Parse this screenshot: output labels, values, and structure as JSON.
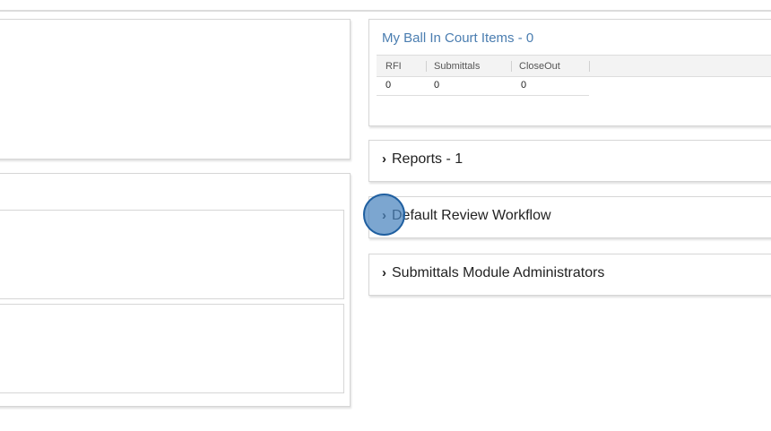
{
  "ball_in_court": {
    "title": "My Ball In Court Items - 0",
    "columns": [
      "RFI",
      "Submittals",
      "CloseOut"
    ],
    "rows": [
      [
        "0",
        "0",
        "0"
      ]
    ]
  },
  "accordions": [
    {
      "label": "Reports - 1",
      "icon": "chevron-right-icon"
    },
    {
      "label": "Default Review Workflow",
      "icon": "chevron-right-icon"
    },
    {
      "label": "Submittals Module Administrators",
      "icon": "chevron-right-icon"
    }
  ],
  "colors": {
    "title_blue": "#4a7db0",
    "cursor_fill": "#4a84be",
    "border": "#d6d6d6"
  }
}
